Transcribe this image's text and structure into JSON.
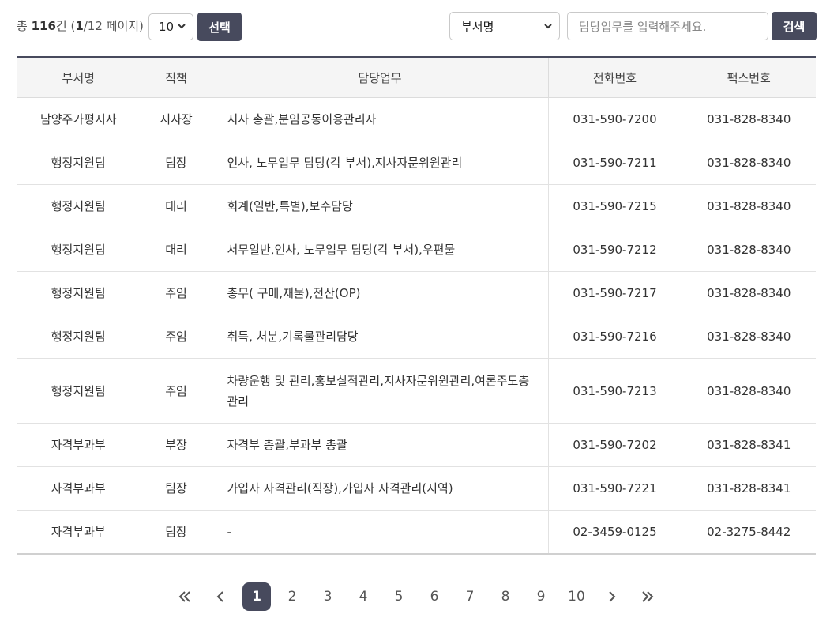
{
  "summary": {
    "prefix": "총 ",
    "total": "116",
    "unit": "건 (",
    "page": "1",
    "rest": "/12 페이지)"
  },
  "page_size": {
    "value": "10"
  },
  "select_button": "선택",
  "dept_filter": {
    "value": "부서명"
  },
  "search": {
    "placeholder": "담당업무를 입력해주세요.",
    "button": "검색"
  },
  "table": {
    "headers": [
      "부서명",
      "직책",
      "담당업무",
      "전화번호",
      "팩스번호"
    ],
    "rows": [
      [
        "남양주가평지사",
        "지사장",
        "지사 총괄,분임공동이용관리자",
        "031-590-7200",
        "031-828-8340"
      ],
      [
        "행정지원팀",
        "팀장",
        "인사, 노무업무 담당(각 부서),지사자문위원관리",
        "031-590-7211",
        "031-828-8340"
      ],
      [
        "행정지원팀",
        "대리",
        "회계(일반,특별),보수담당",
        "031-590-7215",
        "031-828-8340"
      ],
      [
        "행정지원팀",
        "대리",
        "서무일반,인사, 노무업무 담당(각 부서),우편물",
        "031-590-7212",
        "031-828-8340"
      ],
      [
        "행정지원팀",
        "주임",
        "총무( 구매,재물),전산(OP)",
        "031-590-7217",
        "031-828-8340"
      ],
      [
        "행정지원팀",
        "주임",
        "취득, 처분,기록물관리담당",
        "031-590-7216",
        "031-828-8340"
      ],
      [
        "행정지원팀",
        "주임",
        "차량운행 및 관리,홍보실적관리,지사자문위원관리,여론주도층관리",
        "031-590-7213",
        "031-828-8340"
      ],
      [
        "자격부과부",
        "부장",
        "자격부 총괄,부과부 총괄",
        "031-590-7202",
        "031-828-8341"
      ],
      [
        "자격부과부",
        "팀장",
        "가입자 자격관리(직장),가입자 자격관리(지역)",
        "031-590-7221",
        "031-828-8341"
      ],
      [
        "자격부과부",
        "팀장",
        "-",
        "02-3459-0125",
        "02-3275-8442"
      ]
    ]
  },
  "pagination": {
    "pages": [
      "1",
      "2",
      "3",
      "4",
      "5",
      "6",
      "7",
      "8",
      "9",
      "10"
    ],
    "current": "1"
  },
  "colors": {
    "accent": "#474a5d",
    "header_bg": "#f5f5f5"
  }
}
